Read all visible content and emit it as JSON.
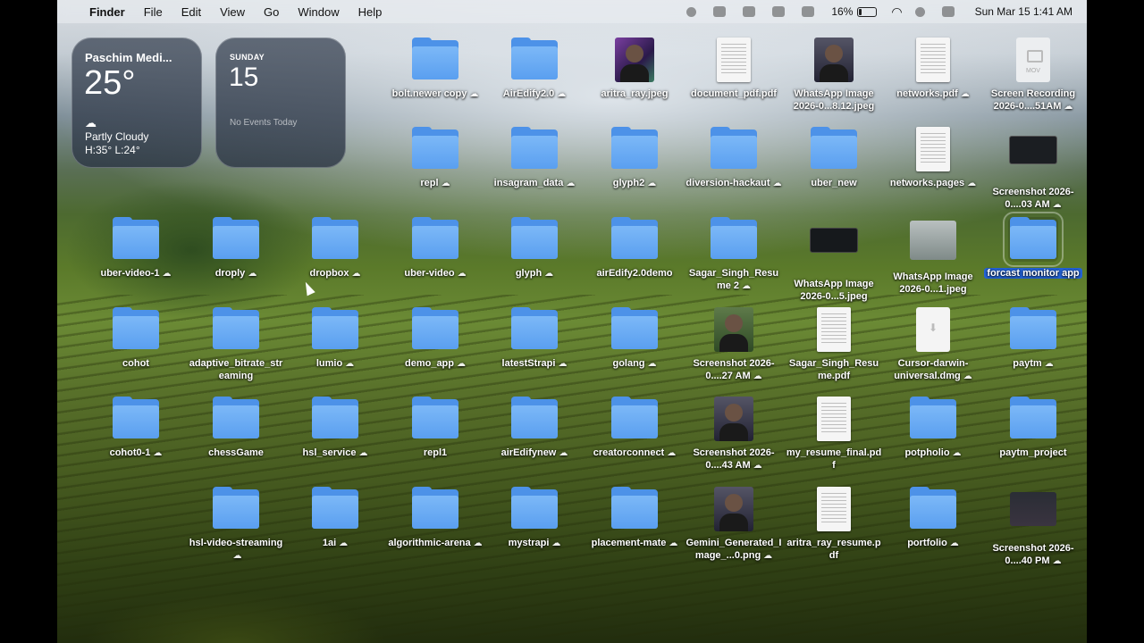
{
  "menubar": {
    "app": "Finder",
    "menus": [
      "File",
      "Edit",
      "View",
      "Go",
      "Window",
      "Help"
    ],
    "battery": "16%",
    "battery_level": 0.16,
    "clock": "Sun Mar 15  1:41 AM"
  },
  "weather": {
    "city": "Paschim Medi...",
    "temp": "25°",
    "condition": "Partly Cloudy",
    "high_low": "H:35° L:24°"
  },
  "calendar": {
    "day": "SUNDAY",
    "date": "15",
    "events": "No Events Today"
  },
  "items": [
    {
      "name": "bolt.newer copy",
      "type": "folder",
      "cloud": true
    },
    {
      "name": "AirEdify2.0",
      "type": "folder",
      "cloud": true
    },
    {
      "name": "aritra_ray.jpeg",
      "type": "photo",
      "cloud": false
    },
    {
      "name": "document_pdf.pdf",
      "type": "doc",
      "cloud": false
    },
    {
      "name": "WhatsApp Image 2026-0...8.12.jpeg",
      "type": "photo",
      "cloud": false
    },
    {
      "name": "networks.pdf",
      "type": "doc",
      "cloud": true
    },
    {
      "name": "Screen Recording 2026-0....51AM",
      "type": "mov",
      "cloud": true
    },
    {
      "name": "repl",
      "type": "folder",
      "cloud": true
    },
    {
      "name": "insagram_data",
      "type": "folder",
      "cloud": true
    },
    {
      "name": "glyph2",
      "type": "folder",
      "cloud": true
    },
    {
      "name": "diversion-hackaut",
      "type": "folder",
      "cloud": true
    },
    {
      "name": "uber_new",
      "type": "folder",
      "cloud": false
    },
    {
      "name": "networks.pages",
      "type": "doc",
      "cloud": true
    },
    {
      "name": "Screenshot 2026-0....03 AM",
      "type": "screenshot",
      "cloud": true
    },
    {
      "name": "uber-video-1",
      "type": "folder",
      "cloud": true
    },
    {
      "name": "droply",
      "type": "folder",
      "cloud": true
    },
    {
      "name": "dropbox",
      "type": "folder",
      "cloud": true
    },
    {
      "name": "uber-video",
      "type": "folder",
      "cloud": true
    },
    {
      "name": "glyph",
      "type": "folder",
      "cloud": true
    },
    {
      "name": "airEdify2.0demo",
      "type": "folder",
      "cloud": false
    },
    {
      "name": "Sagar_Singh_Resume 2",
      "type": "folder",
      "cloud": true
    },
    {
      "name": "WhatsApp Image 2026-0...5.jpeg",
      "type": "dark",
      "cloud": false
    },
    {
      "name": "WhatsApp Image 2026-0...1.jpeg",
      "type": "chat",
      "cloud": false
    },
    {
      "name": "forcast monitor app",
      "type": "folder",
      "cloud": false,
      "selected": true
    },
    {
      "name": "cohot",
      "type": "folder",
      "cloud": false
    },
    {
      "name": "adaptive_bitrate_streaming",
      "type": "folder",
      "cloud": false
    },
    {
      "name": "lumio",
      "type": "folder",
      "cloud": true
    },
    {
      "name": "demo_app",
      "type": "folder",
      "cloud": true
    },
    {
      "name": "latestStrapi",
      "type": "folder",
      "cloud": true
    },
    {
      "name": "golang",
      "type": "folder",
      "cloud": true
    },
    {
      "name": "Screenshot 2026-0....27 AM",
      "type": "outdoor",
      "cloud": true
    },
    {
      "name": "Sagar_Singh_Resume.pdf",
      "type": "doc",
      "cloud": false
    },
    {
      "name": "Cursor-darwin-universal.dmg",
      "type": "dmg",
      "cloud": true
    },
    {
      "name": "paytm",
      "type": "folder",
      "cloud": true
    },
    {
      "name": "cohot0-1",
      "type": "folder",
      "cloud": true
    },
    {
      "name": "chessGame",
      "type": "folder",
      "cloud": false
    },
    {
      "name": "hsl_service",
      "type": "folder",
      "cloud": true
    },
    {
      "name": "repl1",
      "type": "folder",
      "cloud": false
    },
    {
      "name": "airEdifynew",
      "type": "folder",
      "cloud": true
    },
    {
      "name": "creatorconnect",
      "type": "folder",
      "cloud": true
    },
    {
      "name": "Screenshot 2026-0....43 AM",
      "type": "photo",
      "cloud": true
    },
    {
      "name": "my_resume_final.pdf",
      "type": "doc",
      "cloud": false
    },
    {
      "name": "potpholio",
      "type": "folder",
      "cloud": true
    },
    {
      "name": "paytm_project",
      "type": "folder",
      "cloud": false
    },
    {
      "name": "hsl-video-streaming",
      "type": "folder",
      "cloud": true
    },
    {
      "name": "1ai",
      "type": "folder",
      "cloud": true
    },
    {
      "name": "algorithmic-arena",
      "type": "folder",
      "cloud": true
    },
    {
      "name": "mystrapi",
      "type": "folder",
      "cloud": true
    },
    {
      "name": "placement-mate",
      "type": "folder",
      "cloud": true
    },
    {
      "name": "Gemini_Generated_Image_...0.png",
      "type": "photo",
      "cloud": true
    },
    {
      "name": "aritra_ray_resume.pdf",
      "type": "doc",
      "cloud": false
    },
    {
      "name": "portfolio",
      "type": "folder",
      "cloud": true
    },
    {
      "name": "Screenshot 2026-0....40 PM",
      "type": "screen2",
      "cloud": true
    }
  ]
}
